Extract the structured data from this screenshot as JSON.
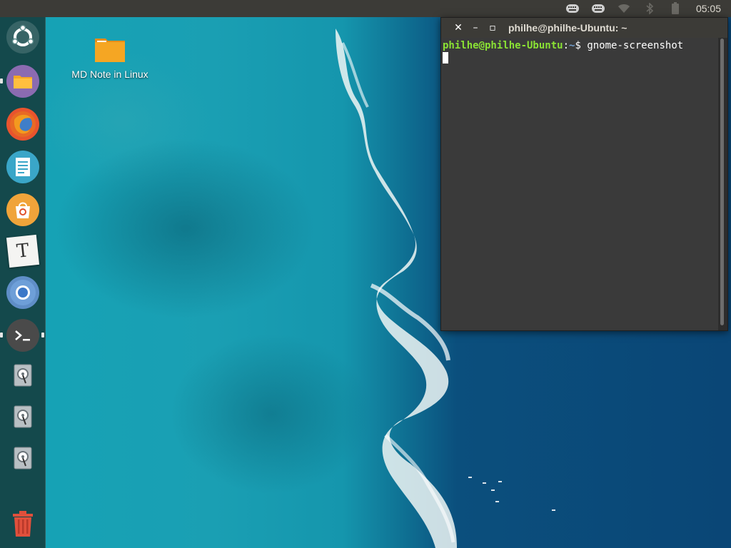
{
  "top_panel": {
    "clock": "05:05",
    "indicators": [
      "keyboard-icon",
      "keyboard-icon",
      "wifi-icon",
      "bluetooth-icon",
      "battery-icon"
    ]
  },
  "launcher": {
    "items": [
      {
        "name": "ubuntu-dash-icon",
        "running": false
      },
      {
        "name": "files-icon",
        "running": true
      },
      {
        "name": "firefox-icon",
        "running": false
      },
      {
        "name": "text-editor-icon",
        "running": false
      },
      {
        "name": "software-center-icon",
        "running": false
      },
      {
        "name": "typora-icon",
        "glyph": "T",
        "running": false
      },
      {
        "name": "chromium-icon",
        "running": false
      },
      {
        "name": "terminal-icon",
        "running": true
      },
      {
        "name": "disk-icon",
        "running": false
      },
      {
        "name": "disk-icon",
        "running": false
      },
      {
        "name": "disk-icon",
        "running": false
      },
      {
        "name": "trash-icon",
        "running": false
      }
    ]
  },
  "desktop": {
    "icons": [
      {
        "label": "MD Note in Linux",
        "icon": "folder-icon"
      }
    ]
  },
  "terminal": {
    "title": "philhe@philhe-Ubuntu: ~",
    "prompt_user": "philhe@philhe-Ubuntu",
    "prompt_sep": ":",
    "prompt_path": "~",
    "prompt_symbol": "$ ",
    "command": "gnome-screenshot",
    "close_glyph": "✕",
    "minimize_glyph": "–",
    "maximize_glyph": "▫"
  },
  "colors": {
    "panel": "#3c3b37",
    "launcher": "#143c3e",
    "prompt_user": "#8ae234",
    "prompt_path": "#729fcf",
    "folder": "#f5a623"
  }
}
